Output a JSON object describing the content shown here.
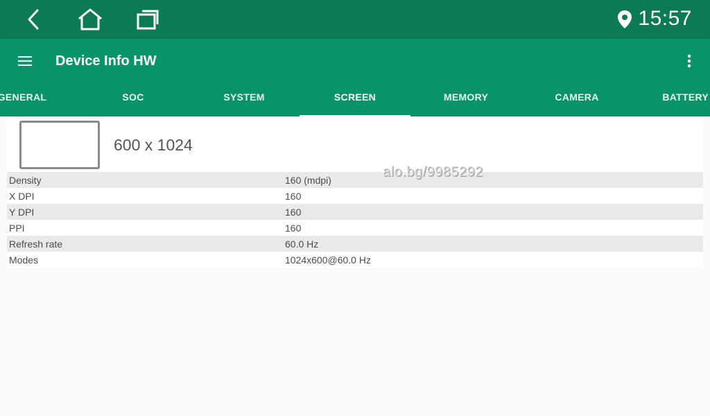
{
  "statusbar": {
    "time": "15:57",
    "icons": [
      "back-icon",
      "home-icon",
      "recent-apps-icon",
      "location-icon"
    ]
  },
  "appbar": {
    "title": "Device Info HW",
    "icons": [
      "menu-icon",
      "more-vert-icon"
    ]
  },
  "tabs": [
    {
      "label": "GENERAL",
      "active": false
    },
    {
      "label": "SOC",
      "active": false
    },
    {
      "label": "SYSTEM",
      "active": false
    },
    {
      "label": "SCREEN",
      "active": true
    },
    {
      "label": "MEMORY",
      "active": false
    },
    {
      "label": "CAMERA",
      "active": false
    },
    {
      "label": "BATTERY",
      "active": false
    }
  ],
  "screen": {
    "resolution": "600 x 1024",
    "rows": [
      {
        "key": "Density",
        "value": "160 (mdpi)"
      },
      {
        "key": "X DPI",
        "value": "160"
      },
      {
        "key": "Y DPI",
        "value": "160"
      },
      {
        "key": "PPI",
        "value": "160"
      },
      {
        "key": "Refresh rate",
        "value": "60.0 Hz"
      },
      {
        "key": "Modes",
        "value": "1024x600@60.0 Hz"
      }
    ]
  },
  "watermark": "alo.bg/9985292",
  "colors": {
    "status_bar": "#0b7a55",
    "app_bar": "#089468",
    "tab_indicator": "#ffffff"
  }
}
